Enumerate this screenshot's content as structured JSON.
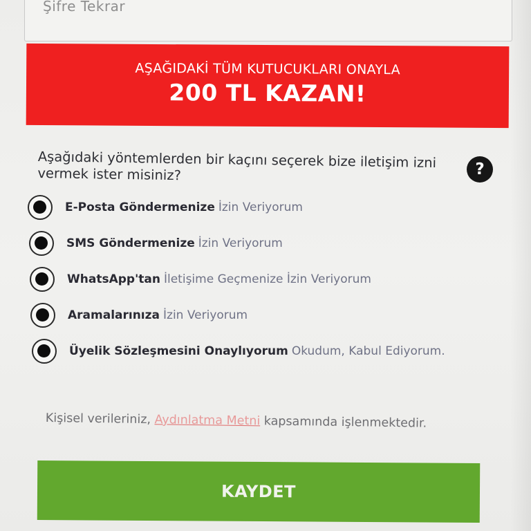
{
  "password_repeat": {
    "placeholder": "Şifre Tekrar"
  },
  "promo": {
    "line1": "AŞAĞIDAKİ TÜM KUTUCUKLARI ONAYLA",
    "line2": "200 TL KAZAN!",
    "background_color": "#ef2020"
  },
  "consent": {
    "question": "Aşağıdaki yöntemlerden bir kaçını seçerek bize iletişim izni vermek ister misiniz?",
    "help_icon": "question-mark-icon",
    "help_label": "?",
    "options": [
      {
        "strong": "E-Posta Göndermenize",
        "light": "İzin Veriyorum",
        "checked": true
      },
      {
        "strong": "SMS Göndermenize",
        "light": "İzin Veriyorum",
        "checked": true
      },
      {
        "strong": "WhatsApp'tan",
        "light": "İletişime Geçmenize İzin Veriyorum",
        "checked": true
      },
      {
        "strong": "Aramalarınıza",
        "light": "İzin Veriyorum",
        "checked": true
      },
      {
        "strong": "Üyelik Sözleşmesini Onaylıyorum",
        "light": "Okudum, Kabul Ediyorum.",
        "checked": true
      }
    ]
  },
  "kvkk": {
    "before": "Kişisel verileriniz, ",
    "link": "Aydınlatma Metni",
    "after": " kapsamında işlenmektedir."
  },
  "save_button": {
    "label": "KAYDET",
    "color": "#62a82e"
  }
}
